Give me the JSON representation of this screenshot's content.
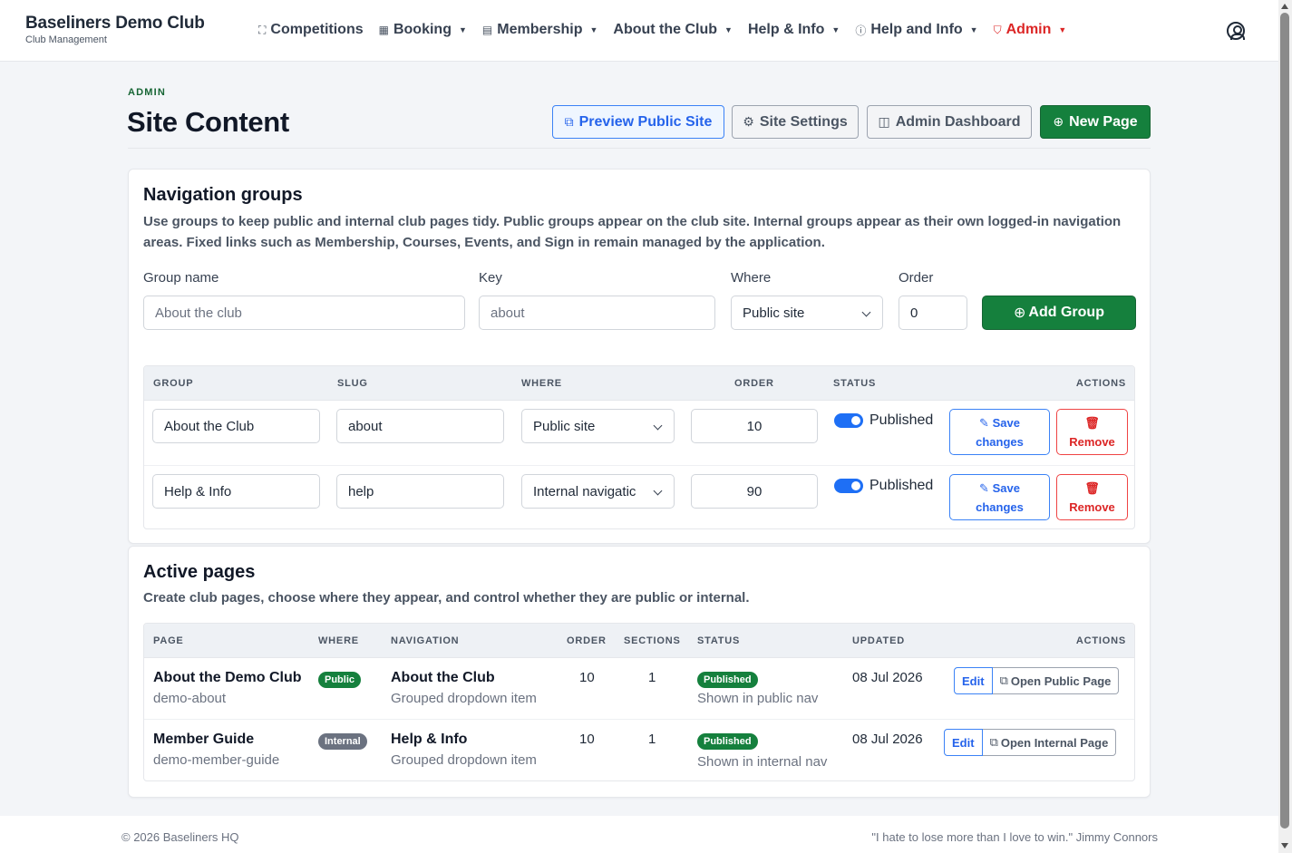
{
  "brand": {
    "name": "Baseliners Demo Club",
    "subtitle": "Club Management"
  },
  "nav": [
    {
      "label": "Competitions",
      "icon": "sitemap-icon",
      "glyph": "⛶",
      "dropdown": false
    },
    {
      "label": "Booking",
      "icon": "calendar-icon",
      "glyph": "▦",
      "dropdown": true
    },
    {
      "label": "Membership",
      "icon": "id-card-icon",
      "glyph": "▤",
      "dropdown": true
    },
    {
      "label": "About the Club",
      "icon": "",
      "glyph": "",
      "dropdown": true
    },
    {
      "label": "Help & Info",
      "icon": "",
      "glyph": "",
      "dropdown": true
    },
    {
      "label": "Help and Info",
      "icon": "info-circle-icon",
      "glyph": "ⓘ",
      "dropdown": true
    },
    {
      "label": "Admin",
      "icon": "shield-icon",
      "glyph": "⛉",
      "dropdown": true
    }
  ],
  "header": {
    "eyebrow": "ADMIN",
    "title": "Site Content",
    "buttons": {
      "preview": "Preview Public Site",
      "settings": "Site Settings",
      "dashboard": "Admin Dashboard",
      "new_page": "New Page"
    }
  },
  "groups_card": {
    "title": "Navigation groups",
    "description": "Use groups to keep public and internal club pages tidy. Public groups appear on the club site. Internal groups appear as their own logged-in navigation areas. Fixed links such as Membership, Courses, Events, and Sign in remain managed by the application.",
    "form": {
      "group_name_label": "Group name",
      "group_name_placeholder": "About the club",
      "key_label": "Key",
      "key_placeholder": "about",
      "where_label": "Where",
      "where_value": "Public site",
      "order_label": "Order",
      "order_value": "0",
      "add_button": "Add Group"
    },
    "columns": [
      "GROUP",
      "SLUG",
      "WHERE",
      "ORDER",
      "STATUS",
      "ACTIONS"
    ],
    "rows": [
      {
        "group": "About the Club",
        "slug": "about",
        "where": "Public site",
        "order": "10",
        "status": "Published",
        "save_1": "Save",
        "save_2": "changes",
        "remove": "Remove"
      },
      {
        "group": "Help & Info",
        "slug": "help",
        "where": "Internal navigatic",
        "order": "90",
        "status": "Published",
        "save_1": "Save",
        "save_2": "changes",
        "remove": "Remove"
      }
    ]
  },
  "pages_card": {
    "title": "Active pages",
    "description": "Create club pages, choose where they appear, and control whether they are public or internal.",
    "columns": [
      "PAGE",
      "WHERE",
      "NAVIGATION",
      "ORDER",
      "SECTIONS",
      "STATUS",
      "UPDATED",
      "ACTIONS"
    ],
    "rows": [
      {
        "page": "About the Demo Club",
        "slug": "demo-about",
        "where": "Public",
        "navigation": "About the Club",
        "nav_sub": "Grouped dropdown item",
        "order": "10",
        "sections": "1",
        "status": "Published",
        "status_sub": "Shown in public nav",
        "updated": "08 Jul 2026",
        "edit": "Edit",
        "open": "Open Public Page"
      },
      {
        "page": "Member Guide",
        "slug": "demo-member-guide",
        "where": "Internal",
        "navigation": "Help & Info",
        "nav_sub": "Grouped dropdown item",
        "order": "10",
        "sections": "1",
        "status": "Published",
        "status_sub": "Shown in internal nav",
        "updated": "08 Jul 2026",
        "edit": "Edit",
        "open": "Open Internal Page"
      }
    ]
  },
  "footer": {
    "copyright": "© 2026 Baseliners HQ",
    "quote": "\"I hate to lose more than I love to win.\" Jimmy Connors"
  },
  "colors": {
    "primary_green": "#15803d",
    "link_blue": "#2563eb",
    "danger_red": "#dc2626",
    "toggle_blue": "#1e6ff5"
  }
}
